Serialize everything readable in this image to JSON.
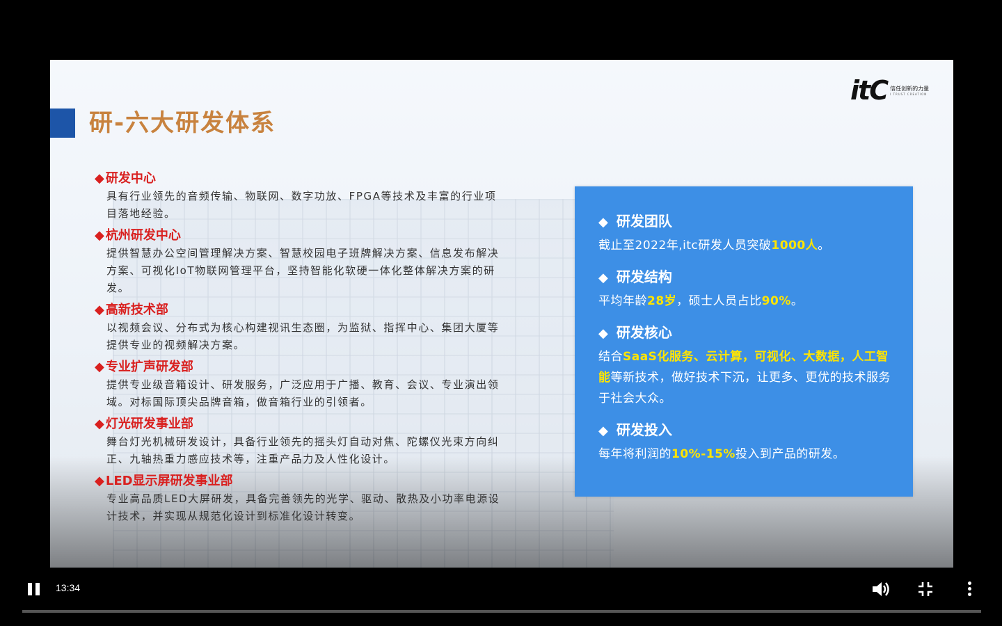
{
  "slide": {
    "title": "研-六大研发体系",
    "logo": {
      "mark": "itC",
      "tagline": "信任创新的力量",
      "sub": "I TRUST CREATION"
    },
    "sections": [
      {
        "title": "研发中心",
        "lines": [
          "具有行业领先的音频传输、物联网、数字功放、FPGA等技术及丰富的行业项",
          "目落地经验。"
        ]
      },
      {
        "title": "杭州研发中心",
        "lines": [
          "提供智慧办公空间管理解决方案、智慧校园电子班牌解决方案、信息发布解决",
          "方案、可视化IoT物联网管理平台，坚持智能化软硬一体化整体解决方案的研",
          "发。"
        ]
      },
      {
        "title": "高新技术部",
        "lines": [
          "以视频会议、分布式为核心构建视讯生态圈，为监狱、指挥中心、集团大厦等",
          "提供专业的视频解决方案。"
        ]
      },
      {
        "title": "专业扩声研发部",
        "lines": [
          "提供专业级音箱设计、研发服务，广泛应用于广播、教育、会议、专业演出领",
          "域。对标国际顶尖品牌音箱，做音箱行业的引领者。"
        ]
      },
      {
        "title": "灯光研发事业部",
        "lines": [
          "舞台灯光机械研发设计，具备行业领先的摇头灯自动对焦、陀螺仪光束方向纠",
          "正、九轴热重力感应技术等，注重产品力及人性化设计。"
        ]
      },
      {
        "title": "LED显示屏研发事业部",
        "lines": [
          "专业高品质LED大屏研发，具备完善领先的光学、驱动、散热及小功率电源设",
          "计技术，并实现从规范化设计到标准化设计转变。"
        ]
      }
    ],
    "panel": {
      "team": {
        "title": "研发团队",
        "p1": "截止至2022年,itc研发人员突破",
        "h1": "1000人",
        "p2": "。"
      },
      "structure": {
        "title": "研发结构",
        "p1": "平均年龄",
        "h1": "28岁",
        "p2": "，硕士人员占比",
        "h2": "90%",
        "p3": "。"
      },
      "core": {
        "title": "研发核心",
        "p1": "结合",
        "h1": "SaaS化服务、云计算，可视化、大数据，人工智能",
        "p2": "等新技术，做好技术下沉，让更多、更优的技术服务于社会大众。"
      },
      "invest": {
        "title": "研发投入",
        "p1": "每年将利润的",
        "h1": "10%-15%",
        "p2": "投入到产品的研发。"
      }
    },
    "colors": {
      "title": "#c8823e",
      "section": "#d9201f",
      "panel": "#3d8fe6",
      "highlight": "#ffe400",
      "accent_bar": "#1d55a8"
    }
  },
  "player": {
    "time": "13:34",
    "progress": 0.0,
    "icons": [
      "pause-icon",
      "volume-icon",
      "exit-fullscreen-icon",
      "more-vertical-icon"
    ]
  }
}
